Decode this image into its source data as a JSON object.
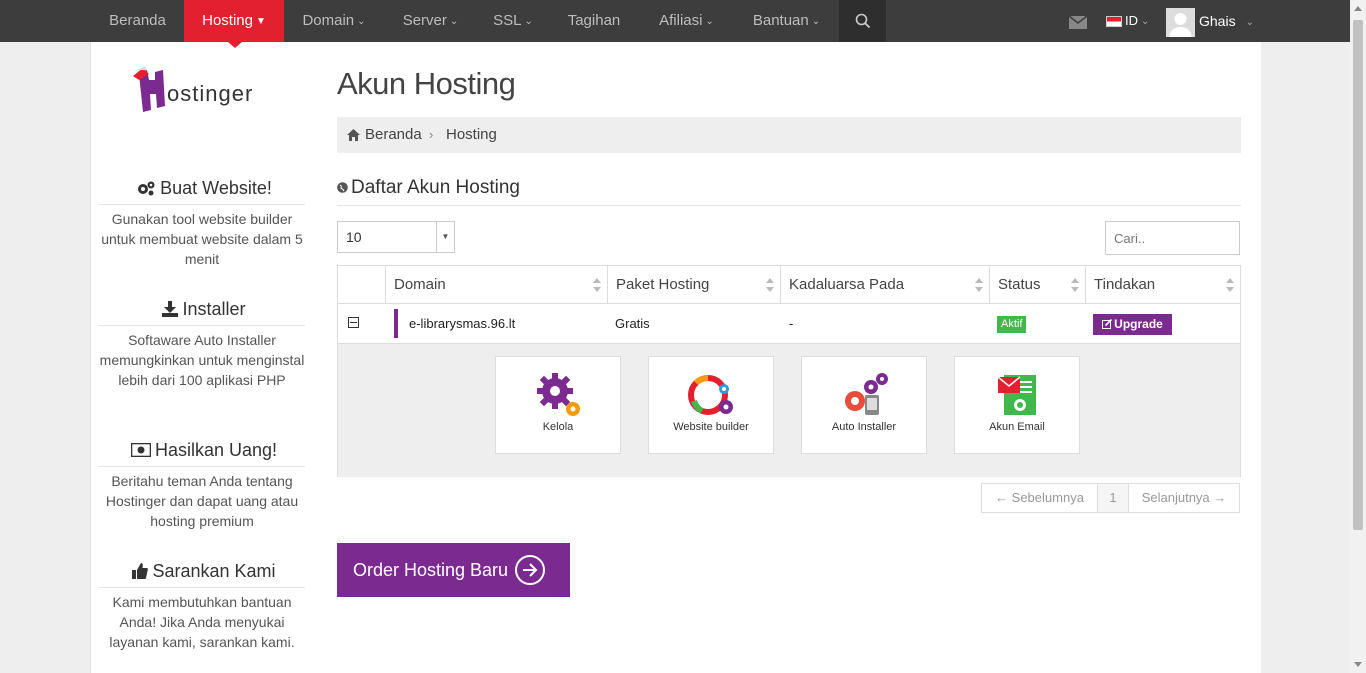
{
  "nav": {
    "items": [
      {
        "label": "Beranda"
      },
      {
        "label": "Hosting"
      },
      {
        "label": "Domain"
      },
      {
        "label": "Server"
      },
      {
        "label": "SSL"
      },
      {
        "label": "Tagihan"
      },
      {
        "label": "Afiliasi"
      },
      {
        "label": "Bantuan"
      }
    ],
    "active": "Hosting",
    "language": "ID",
    "user_name": "Ghais"
  },
  "sidebar": {
    "sections": [
      {
        "title": "Buat Website!",
        "icon": "gears-icon",
        "text": "Gunakan tool website builder untuk membuat website dalam 5 menit"
      },
      {
        "title": "Installer",
        "icon": "download-icon",
        "text": "Softaware Auto Installer memungkinkan untuk menginstal lebih dari 100 aplikasi PHP"
      },
      {
        "title": "Hasilkan Uang!",
        "icon": "money-icon",
        "text": "Beritahu teman Anda tentang Hostinger dan dapat uang atau hosting premium"
      },
      {
        "title": "Sarankan Kami",
        "icon": "thumbs-up-icon",
        "text": "Kami membutuhkan bantuan Anda! Jika Anda menyukai layanan kami, sarankan kami."
      }
    ]
  },
  "main": {
    "page_title": "Akun Hosting",
    "breadcrumb": {
      "home": "Beranda",
      "current": "Hosting"
    },
    "section_title": "Daftar Akun Hosting",
    "page_size": "10",
    "search_placeholder": "Cari..",
    "table": {
      "columns": [
        "Domain",
        "Paket Hosting",
        "Kadaluarsa Pada",
        "Status",
        "Tindakan"
      ],
      "rows": [
        {
          "domain": "e-librarysmas.96.lt",
          "package": "Gratis",
          "expires": "-",
          "status": "Aktif",
          "action": "Upgrade"
        }
      ]
    },
    "tiles": [
      {
        "label": "Kelola",
        "icon": "gear-icon"
      },
      {
        "label": "Website builder",
        "icon": "website-builder-icon"
      },
      {
        "label": "Auto Installer",
        "icon": "auto-installer-icon"
      },
      {
        "label": "Akun Email",
        "icon": "email-account-icon"
      }
    ],
    "pagination": {
      "prev": "← Sebelumnya",
      "page": "1",
      "next": "Selanjutnya →"
    },
    "order_button": "Order Hosting Baru"
  },
  "colors": {
    "nav_bg": "#3d3d3d",
    "active": "#e3202f",
    "brand_purple": "#7b2b8f",
    "status_green": "#41b84b"
  }
}
